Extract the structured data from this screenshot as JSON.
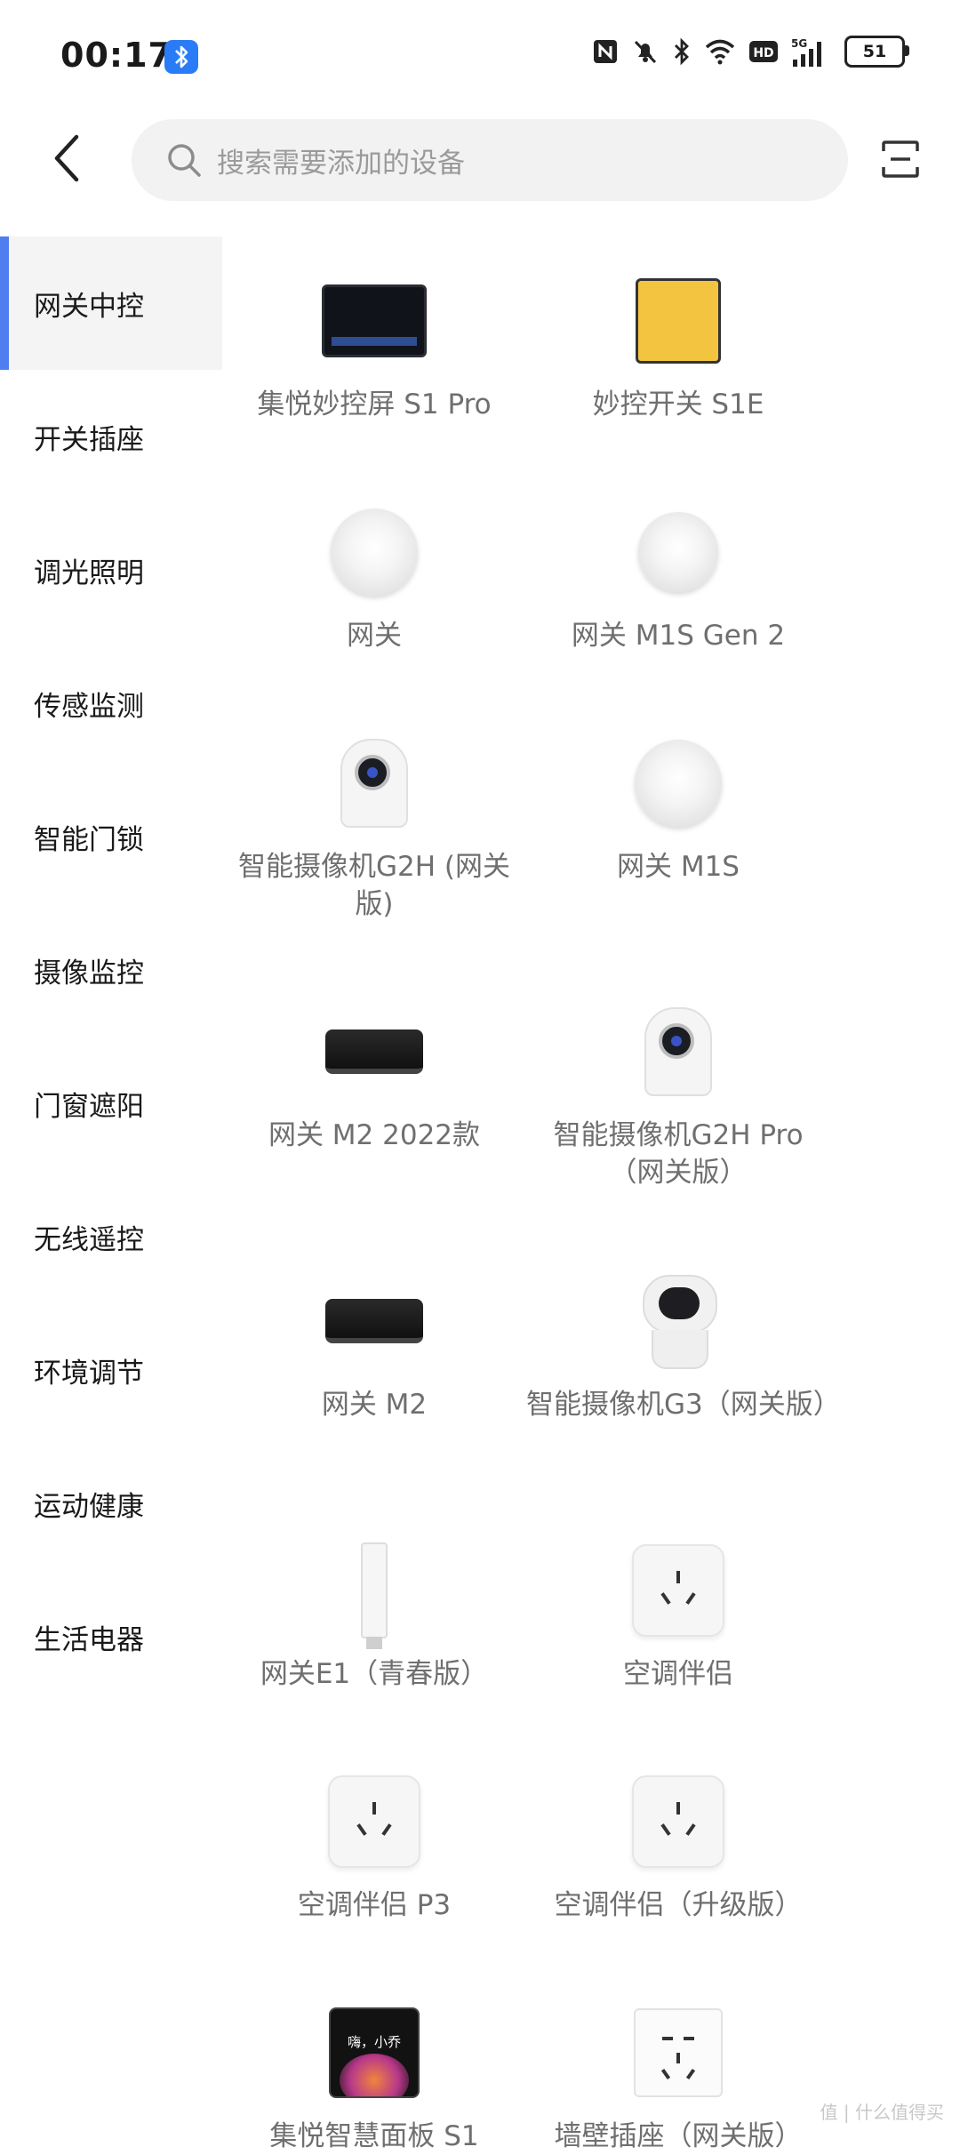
{
  "status_bar": {
    "time": "00:17",
    "battery": "51"
  },
  "search": {
    "placeholder": "搜索需要添加的设备"
  },
  "sidebar": {
    "items": [
      {
        "label": "网关中控",
        "active": true
      },
      {
        "label": "开关插座"
      },
      {
        "label": "调光照明"
      },
      {
        "label": "传感监测"
      },
      {
        "label": "智能门锁"
      },
      {
        "label": "摄像监控"
      },
      {
        "label": "门窗遮阳"
      },
      {
        "label": "无线遥控"
      },
      {
        "label": "环境调节"
      },
      {
        "label": "运动健康"
      },
      {
        "label": "生活电器"
      }
    ]
  },
  "devices": [
    {
      "name": "集悦妙控屏 S1 Pro",
      "icon": "control-screen"
    },
    {
      "name": "妙控开关 S1E",
      "icon": "switch-panel"
    },
    {
      "name": "网关",
      "icon": "hub"
    },
    {
      "name": "网关 M1S Gen 2",
      "icon": "hub"
    },
    {
      "name": "智能摄像机G2H (网关版)",
      "icon": "camera"
    },
    {
      "name": "网关 M1S",
      "icon": "hub"
    },
    {
      "name": "网关 M2 2022款",
      "icon": "box-gateway"
    },
    {
      "name": "智能摄像机G2H Pro（网关版）",
      "icon": "camera"
    },
    {
      "name": "网关 M2",
      "icon": "box-gateway"
    },
    {
      "name": "智能摄像机G3（网关版）",
      "icon": "pan-camera"
    },
    {
      "name": "网关E1（青春版）",
      "icon": "usb-stick"
    },
    {
      "name": "空调伴侣",
      "icon": "ac-plug"
    },
    {
      "name": "空调伴侣 P3",
      "icon": "ac-plug"
    },
    {
      "name": "空调伴侣（升级版）",
      "icon": "ac-plug"
    },
    {
      "name": "集悦智慧面板 S1",
      "icon": "smart-panel"
    },
    {
      "name": "墙壁插座（网关版）",
      "icon": "wall-socket"
    }
  ],
  "panel_screen_text": "嗨，小乔",
  "watermark": "值 | 什么值得买"
}
